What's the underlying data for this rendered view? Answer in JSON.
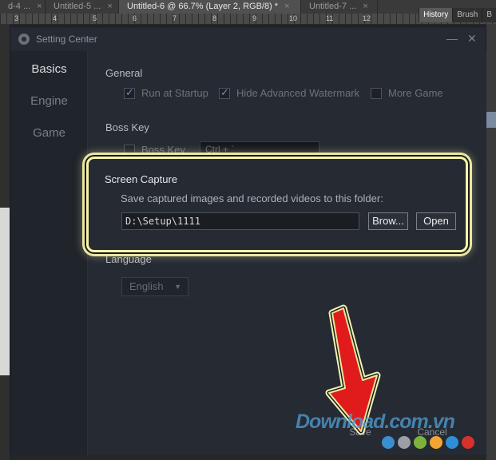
{
  "tabs": [
    {
      "label": "d-4 ...",
      "close": "×"
    },
    {
      "label": "Untitled-5 ...",
      "close": "×"
    },
    {
      "label": "Untitled-6 @ 66.7% (Layer 2, RGB/8) *",
      "close": "×",
      "active": true
    },
    {
      "label": "Untitled-7 ...",
      "close": "×"
    }
  ],
  "ruler_ticks": [
    "3",
    "4",
    "5",
    "6",
    "7",
    "8",
    "9",
    "10",
    "11",
    "12"
  ],
  "panel_tabs": [
    "History",
    "Brush",
    "B"
  ],
  "dialog": {
    "title": "Setting Center",
    "minimize": "—",
    "close": "✕",
    "nav": [
      "Basics",
      "Engine",
      "Game"
    ],
    "general": {
      "heading": "General",
      "options": [
        {
          "label": "Run at Startup",
          "checked": true
        },
        {
          "label": "Hide Advanced Watermark",
          "checked": true
        },
        {
          "label": "More Game",
          "checked": false
        }
      ]
    },
    "boss_key": {
      "heading": "Boss Key",
      "option_label": "Boss Key",
      "checked": false,
      "shortcut_value": "Ctrl + `"
    },
    "screen_capture": {
      "heading": "Screen Capture",
      "description": "Save captured images and recorded videos to this folder:",
      "path_value": "D:\\Setup\\1111",
      "browse_label": "Brow...",
      "open_label": "Open"
    },
    "language": {
      "heading": "Language",
      "selected": "English"
    },
    "save_label": "Save",
    "cancel_label": "Cancel"
  },
  "watermark": "Download.com.vn",
  "colors": {
    "highlight": "#f6f4a9",
    "arrow": "#e11b1b",
    "accent": "#6b8fbf",
    "dots": [
      "#3b8fd0",
      "#9aa0a6",
      "#7db33b",
      "#f2a533",
      "#2f8fd6",
      "#d8312b"
    ]
  }
}
